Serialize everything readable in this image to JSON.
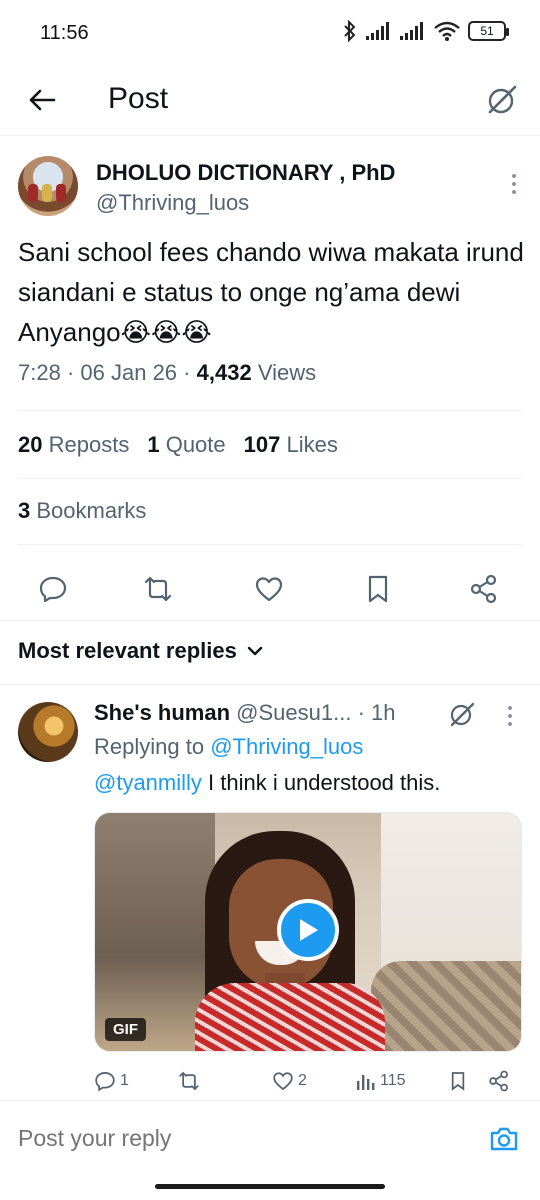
{
  "status_bar": {
    "time": "11:56",
    "battery": "51",
    "icons": [
      "bluetooth-icon",
      "signal-icon",
      "signal-icon",
      "wifi-icon",
      "battery-icon"
    ]
  },
  "topbar": {
    "title": "Post",
    "back_icon": "arrow-left-icon",
    "grok_icon": "grok-icon"
  },
  "post": {
    "author_name": "DHOLUO DICTIONARY , PhD",
    "author_handle": "@Thriving_luos",
    "text": "Sani school fees chando wiwa makata irund siandani e status to onge ng’ama  dewi Anyango😭😭😭",
    "time": "7:28",
    "date": "06 Jan 26",
    "views_count": "4,432",
    "views_label": "Views",
    "reposts_count": "20",
    "reposts_label": "Reposts",
    "quotes_count": "1",
    "quotes_label": "Quote",
    "likes_count": "107",
    "likes_label": "Likes",
    "bookmarks_count": "3",
    "bookmarks_label": "Bookmarks"
  },
  "actions": [
    "reply-icon",
    "repost-icon",
    "like-icon",
    "bookmark-icon",
    "share-icon"
  ],
  "replies_header": "Most relevant replies",
  "reply": {
    "name": "She's human",
    "handle": "@Suesu1...",
    "time": "· 1h",
    "replying_prefix": "Replying to",
    "replying_to": "@Thriving_luos",
    "mention": "@tyanmilly",
    "text": " I think i understood this.",
    "gif_badge": "GIF",
    "reply_count": "1",
    "repost_count": "",
    "like_count": "2",
    "views_count": "115"
  },
  "reply_bar": {
    "placeholder": "Post your reply",
    "camera_icon": "camera-icon"
  },
  "colors": {
    "accent": "#1d9bf0",
    "text": "#0f1419",
    "muted": "#536471",
    "divider": "#eff3f4"
  }
}
